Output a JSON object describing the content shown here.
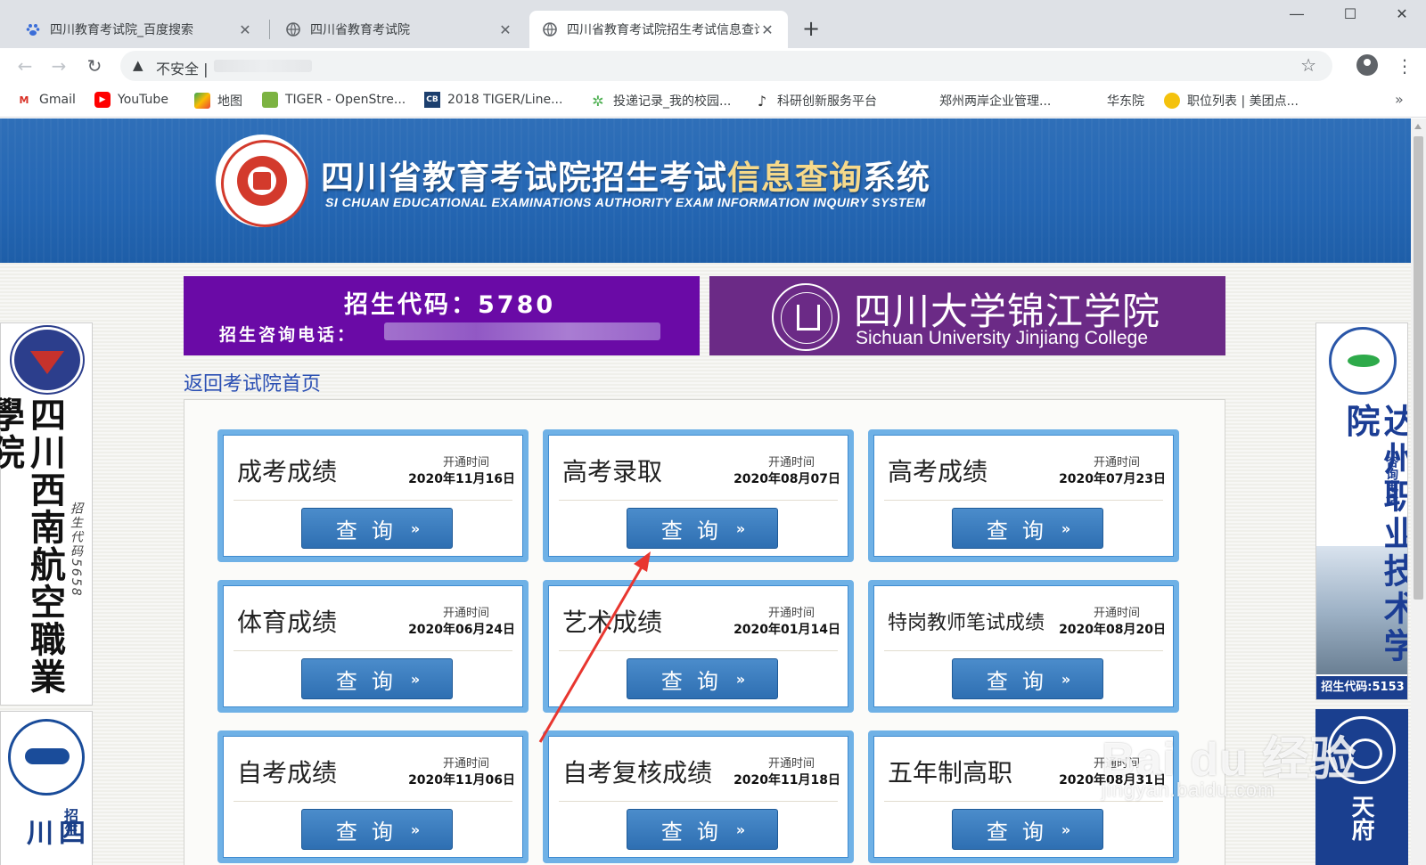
{
  "browser": {
    "tabs": [
      {
        "title": "四川教育考试院_百度搜索",
        "icon": "baidu-paw-icon"
      },
      {
        "title": "四川省教育考试院",
        "icon": "globe-icon"
      },
      {
        "title": "四川省教育考试院招生考试信息查询系统",
        "icon": "globe-icon",
        "active": true
      }
    ],
    "new_tab": "+",
    "address": {
      "security_label": "不安全",
      "separator": "|"
    },
    "bookmarks": [
      {
        "label": "Gmail",
        "icon": "gmail-icon"
      },
      {
        "label": "YouTube",
        "icon": "youtube-icon"
      },
      {
        "label": "地图",
        "icon": "maps-icon"
      },
      {
        "label": "TIGER - OpenStre...",
        "icon": "tiger-icon"
      },
      {
        "label": "2018 TIGER/Line...",
        "icon": "cb-icon"
      },
      {
        "label": "投递记录_我的校园...",
        "icon": "campus-icon"
      },
      {
        "label": "科研创新服务平台",
        "icon": "music-note-icon"
      },
      {
        "label": "郑州两岸企业管理...",
        "icon": ""
      },
      {
        "label": "华东院",
        "icon": ""
      },
      {
        "label": "职位列表 | 美团点...",
        "icon": "meituan-icon"
      }
    ],
    "more_bookmarks": "»"
  },
  "banner": {
    "title_part1": "四川省教育考试院招生考试",
    "title_highlight": "信息查询",
    "title_part2": "系统",
    "subtitle": "SI CHUAN EDUCATIONAL EXAMINATIONS AUTHORITY EXAM INFORMATION INQUIRY SYSTEM"
  },
  "ads": {
    "left_code": "招生代码：5780",
    "left_phone_label": "招生咨询电话：",
    "right_name_cn": "四川大学锦江学院",
    "right_name_en": "Sichuan University Jinjiang College"
  },
  "back_link": "返回考试院首页",
  "time_label": "开通时间",
  "query_label": "查询",
  "query_chevron": "»",
  "cards": [
    {
      "title": "成考成绩",
      "date": "2020年11月16日"
    },
    {
      "title": "高考录取",
      "date": "2020年08月07日"
    },
    {
      "title": "高考成绩",
      "date": "2020年07月23日"
    },
    {
      "title": "体育成绩",
      "date": "2020年06月24日"
    },
    {
      "title": "艺术成绩",
      "date": "2020年01月14日"
    },
    {
      "title": "特岗教师笔试成绩",
      "date": "2020年08月20日"
    },
    {
      "title": "自考成绩",
      "date": "2020年11月06日"
    },
    {
      "title": "自考复核成绩",
      "date": "2020年11月18日"
    },
    {
      "title": "五年制高职",
      "date": "2020年08月31日"
    }
  ],
  "side_ads": {
    "left_top_name": "四川西南航空職業學院",
    "left_top_code": "招生代码5658",
    "left_bottom_name": "四川",
    "left_bottom_sub": "招生",
    "right_top_name": "达州职业技术学院",
    "right_top_sub": "咨询电话",
    "right_top_code": "招生代码:5153",
    "right_bottom_name": "天府"
  },
  "watermark": {
    "text": "Bai du 经验",
    "url": "jingyan.baidu.com"
  },
  "colors": {
    "banner": "#2567b4",
    "ad_left": "#6a0aa6",
    "ad_right": "#6b2a86",
    "card_border": "#6fb1e6",
    "button": "#2e6fb2",
    "arrow": "#e8362f"
  }
}
